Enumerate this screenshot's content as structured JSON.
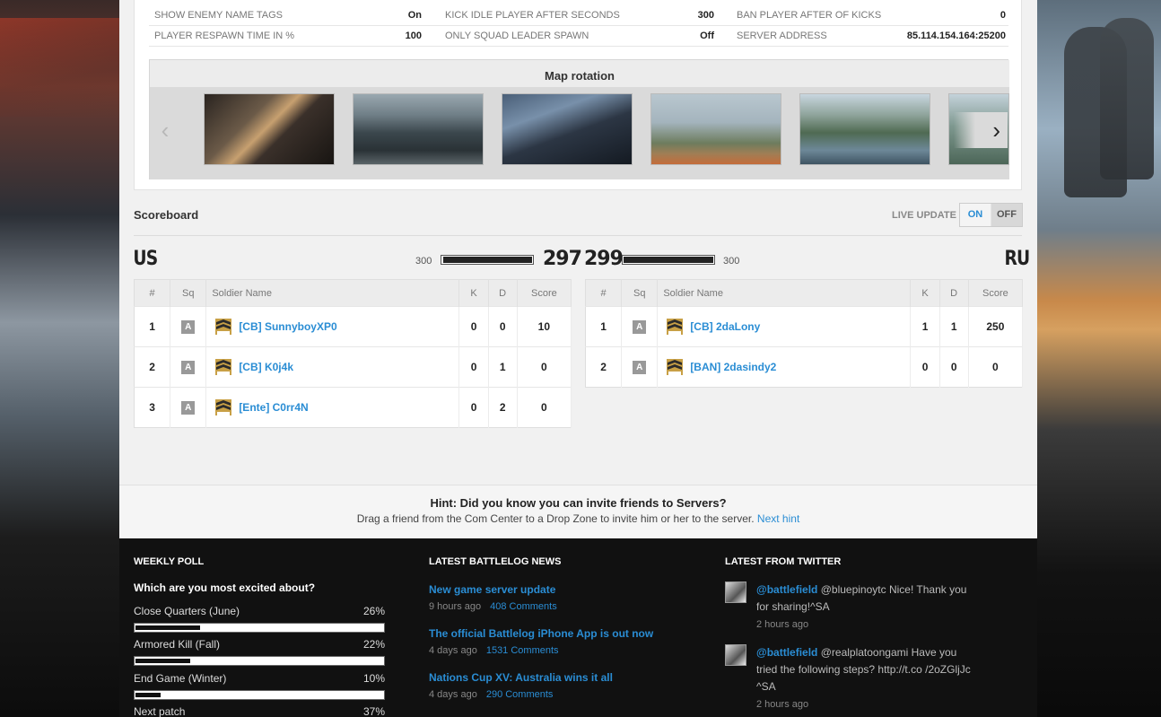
{
  "settings": {
    "rows": [
      [
        {
          "label": "SHOW ENEMY NAME TAGS",
          "value": "On"
        },
        {
          "label": "KICK IDLE PLAYER AFTER SECONDS",
          "value": "300"
        },
        {
          "label": "BAN PLAYER AFTER OF KICKS",
          "value": "0"
        }
      ],
      [
        {
          "label": "PLAYER RESPAWN TIME IN %",
          "value": "100"
        },
        {
          "label": "ONLY SQUAD LEADER SPAWN",
          "value": "Off"
        },
        {
          "label": "SERVER ADDRESS",
          "value": "85.114.154.164:25200"
        }
      ]
    ]
  },
  "map_rotation": {
    "title": "Map rotation",
    "prev_icon": "chevron-left-icon",
    "next_icon": "chevron-right-icon"
  },
  "scoreboard": {
    "title": "Scoreboard",
    "live_update_label": "LIVE UPDATE",
    "toggle_on": "ON",
    "toggle_off": "OFF",
    "columns": [
      "#",
      "Sq",
      "Soldier Name",
      "K",
      "D",
      "Score"
    ],
    "teams": [
      {
        "code": "US",
        "max_tickets": "300",
        "tickets": "297",
        "ticket_fraction": 0.99,
        "players": [
          {
            "rank": "1",
            "squad": "A",
            "name": "[CB] SunnyboyXP0",
            "k": "0",
            "d": "0",
            "score": "10"
          },
          {
            "rank": "2",
            "squad": "A",
            "name": "[CB] K0j4k",
            "k": "0",
            "d": "1",
            "score": "0"
          },
          {
            "rank": "3",
            "squad": "A",
            "name": "[Ente] C0rr4N",
            "k": "0",
            "d": "2",
            "score": "0"
          }
        ]
      },
      {
        "code": "RU",
        "max_tickets": "300",
        "tickets": "299",
        "ticket_fraction": 0.997,
        "players": [
          {
            "rank": "1",
            "squad": "A",
            "name": "[CB] 2daLony",
            "k": "1",
            "d": "1",
            "score": "250"
          },
          {
            "rank": "2",
            "squad": "A",
            "name": "[BAN] 2dasindy2",
            "k": "0",
            "d": "0",
            "score": "0"
          }
        ]
      }
    ]
  },
  "hint": {
    "title": "Hint: Did you know you can invite friends to Servers?",
    "text": "Drag a friend from the Com Center to a Drop Zone to invite him or her to the server.",
    "link": "Next hint"
  },
  "footer": {
    "poll": {
      "heading": "WEEKLY POLL",
      "question": "Which are you most excited about?",
      "options": [
        {
          "label": "Close Quarters (June)",
          "pct": "26%",
          "fraction": 0.26
        },
        {
          "label": "Armored Kill (Fall)",
          "pct": "22%",
          "fraction": 0.22
        },
        {
          "label": "End Game (Winter)",
          "pct": "10%",
          "fraction": 0.1
        },
        {
          "label": "Next patch",
          "pct": "37%",
          "fraction": 0.37
        }
      ]
    },
    "news": {
      "heading": "LATEST BATTLELOG NEWS",
      "items": [
        {
          "title": "New game server update",
          "time": "9 hours ago",
          "comments": "408 Comments"
        },
        {
          "title": "The official Battlelog iPhone App is out now",
          "time": "4 days ago",
          "comments": "1531 Comments"
        },
        {
          "title": "Nations Cup XV: Australia wins it all",
          "time": "4 days ago",
          "comments": "290 Comments"
        }
      ]
    },
    "twitter": {
      "heading": "LATEST FROM TWITTER",
      "items": [
        {
          "handle": "@battlefield",
          "text": "@bluepinoytc Nice! Thank you for sharing!^SA",
          "time": "2 hours ago"
        },
        {
          "handle": "@battlefield",
          "text": "@realplatoongami Have you tried the following steps? http://t.co /2oZGljJc ^SA",
          "time": "2 hours ago"
        }
      ]
    }
  }
}
